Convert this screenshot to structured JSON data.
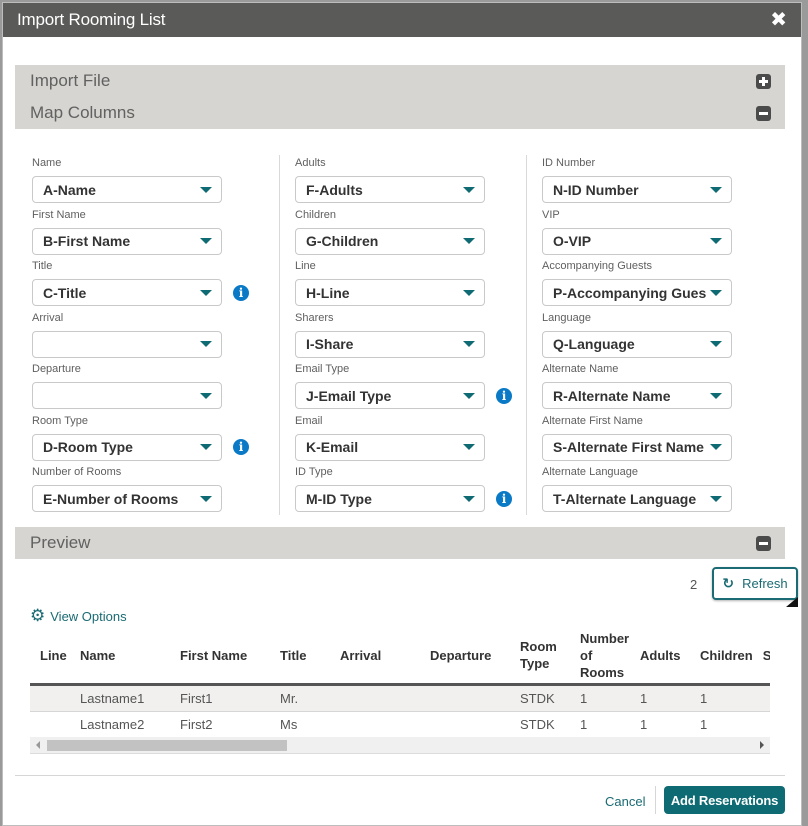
{
  "dialog": {
    "title": "Import Rooming List",
    "close_icon": "close-icon"
  },
  "sections": {
    "import_file": {
      "label": "Import File",
      "state": "collapsed",
      "icon": "plus-icon"
    },
    "map_columns": {
      "label": "Map Columns",
      "state": "expanded",
      "icon": "minus-icon"
    },
    "preview": {
      "label": "Preview",
      "state": "expanded",
      "icon": "minus-icon"
    }
  },
  "mapping": {
    "col1": [
      {
        "label": "Name",
        "value": "A-Name",
        "info": false
      },
      {
        "label": "First Name",
        "value": "B-First Name",
        "info": false
      },
      {
        "label": "Title",
        "value": "C-Title",
        "info": true
      },
      {
        "label": "Arrival",
        "value": "",
        "info": false
      },
      {
        "label": "Departure",
        "value": "",
        "info": false
      },
      {
        "label": "Room Type",
        "value": "D-Room Type",
        "info": true
      },
      {
        "label": "Number of Rooms",
        "value": "E-Number of Rooms",
        "info": false
      }
    ],
    "col2": [
      {
        "label": "Adults",
        "value": "F-Adults",
        "info": false
      },
      {
        "label": "Children",
        "value": "G-Children",
        "info": false
      },
      {
        "label": "Line",
        "value": "H-Line",
        "info": false
      },
      {
        "label": "Sharers",
        "value": "I-Share",
        "info": false
      },
      {
        "label": "Email Type",
        "value": "J-Email Type",
        "info": true
      },
      {
        "label": "Email",
        "value": "K-Email",
        "info": false
      },
      {
        "label": "ID Type",
        "value": "M-ID Type",
        "info": true
      }
    ],
    "col3": [
      {
        "label": "ID Number",
        "value": "N-ID Number",
        "info": false
      },
      {
        "label": "VIP",
        "value": "O-VIP",
        "info": false
      },
      {
        "label": "Accompanying Guests",
        "value": "P-Accompanying Guests",
        "info": false
      },
      {
        "label": "Language",
        "value": "Q-Language",
        "info": false
      },
      {
        "label": "Alternate Name",
        "value": "R-Alternate Name",
        "info": false
      },
      {
        "label": "Alternate First Name",
        "value": "S-Alternate First Name",
        "info": false
      },
      {
        "label": "Alternate Language",
        "value": "T-Alternate Language",
        "info": false
      }
    ]
  },
  "preview": {
    "record_count": "2",
    "refresh_label": "Refresh",
    "view_options_label": "View Options",
    "columns": [
      "Line",
      "Name",
      "First Name",
      "Title",
      "Arrival",
      "Departure",
      "Room Type",
      "Number of Rooms",
      "Adults",
      "Children",
      "Sh"
    ],
    "rows": [
      [
        "",
        "Lastname1",
        "First1",
        "Mr.",
        "",
        "",
        "STDK",
        "1",
        "1",
        "1",
        ""
      ],
      [
        "",
        "Lastname2",
        "First2",
        "Ms",
        "",
        "",
        "STDK",
        "1",
        "1",
        "1",
        ""
      ]
    ]
  },
  "footer": {
    "cancel_label": "Cancel",
    "add_reservations_label": "Add Reservations"
  }
}
